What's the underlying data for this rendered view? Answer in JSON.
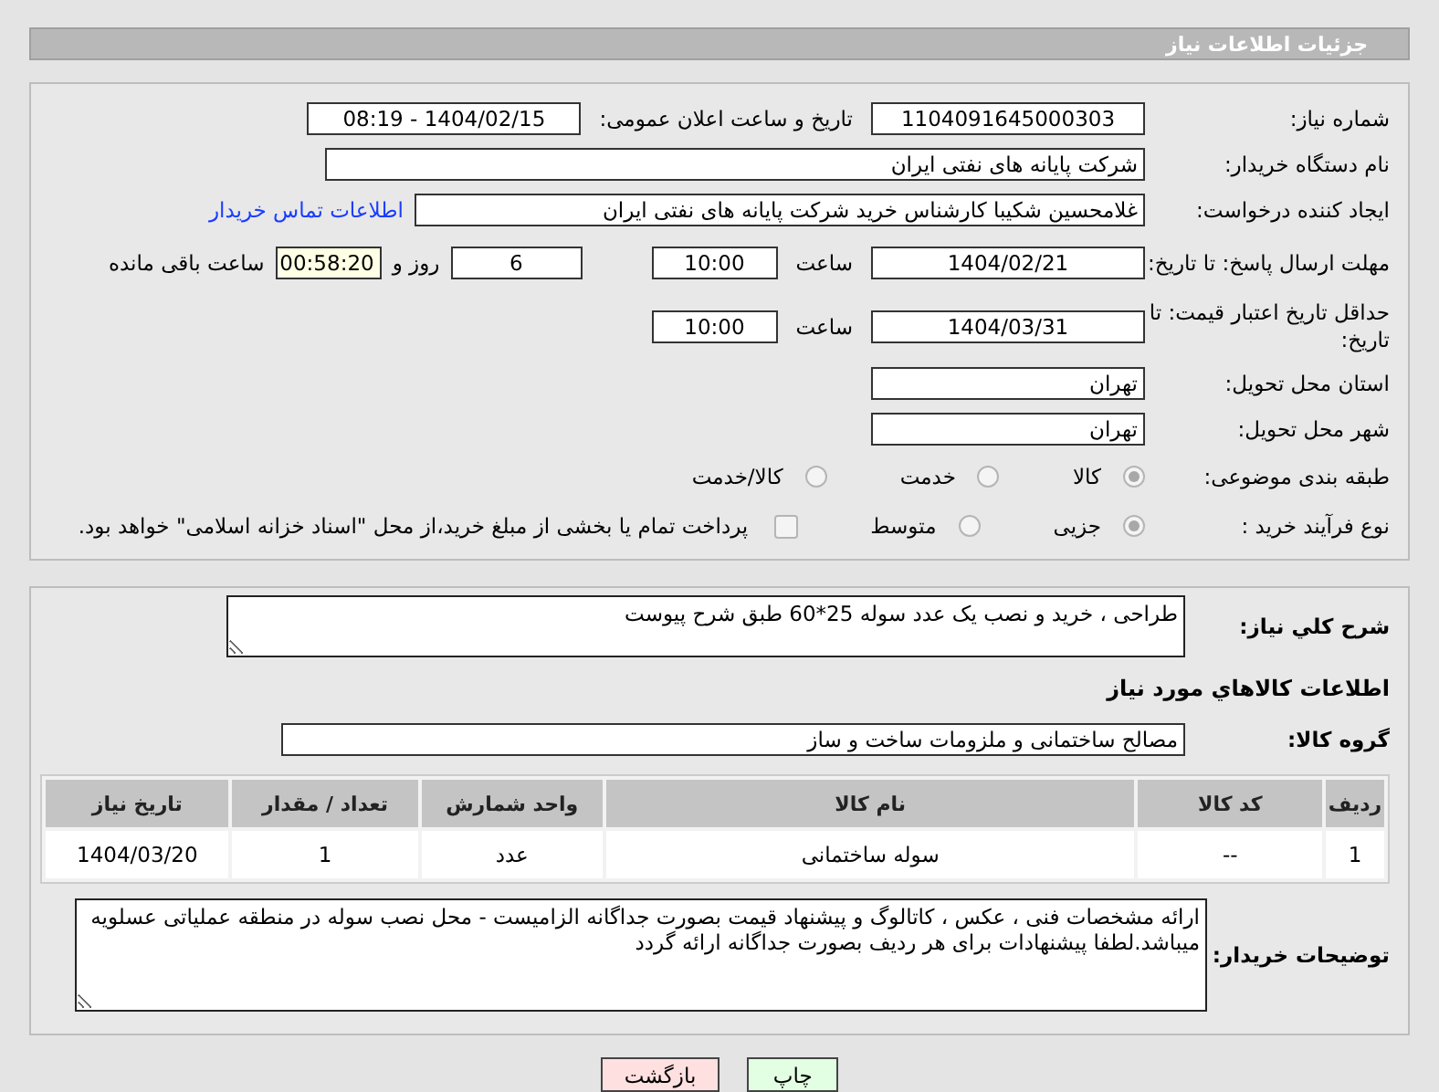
{
  "header": {
    "title": "جزئیات اطلاعات نیاز"
  },
  "need_number": {
    "label": "شماره نیاز:",
    "value": "1104091645000303"
  },
  "announce": {
    "label": "تاریخ و ساعت اعلان عمومی:",
    "value": "1404/02/15 - 08:19"
  },
  "buyer_org": {
    "label": "نام دستگاه خریدار:",
    "value": "شرکت پایانه های نفتی ایران"
  },
  "requester": {
    "label": "ایجاد کننده درخواست:",
    "value": "غلامحسین شکیبا کارشناس خرید شرکت پایانه های نفتی ایران",
    "link": "اطلاعات تماس خریدار"
  },
  "response_deadline": {
    "label": "مهلت ارسال پاسخ: تا تاریخ:",
    "date": "1404/02/21",
    "time_label": "ساعت",
    "time": "10:00",
    "days": "6",
    "days_label": "روز و",
    "remaining": "00:58:20",
    "remaining_label": "ساعت باقی مانده"
  },
  "price_validity": {
    "label": "حداقل تاریخ اعتبار قیمت: تا تاریخ:",
    "date": "1404/03/31",
    "time_label": "ساعت",
    "time": "10:00"
  },
  "province": {
    "label": "استان محل تحویل:",
    "value": "تهران"
  },
  "city": {
    "label": "شهر محل تحویل:",
    "value": "تهران"
  },
  "category": {
    "label": "طبقه بندی موضوعی:",
    "options": [
      {
        "label": "کالا",
        "selected": true
      },
      {
        "label": "خدمت",
        "selected": false
      },
      {
        "label": "کالا/خدمت",
        "selected": false
      }
    ]
  },
  "process": {
    "label": "نوع فرآیند خرید :",
    "options": [
      {
        "label": "جزیی",
        "selected": true
      },
      {
        "label": "متوسط",
        "selected": false
      }
    ],
    "payment": {
      "checked": false,
      "text": "پرداخت تمام یا بخشی از مبلغ خرید،از محل \"اسناد خزانه اسلامی\" خواهد بود."
    }
  },
  "description": {
    "label": "شرح کلي نياز:",
    "value": "طراحی ، خرید و نصب یک عدد سوله 25*60 طبق شرح پیوست"
  },
  "goods_heading": "اطلاعات كالاهاي مورد نياز",
  "goods_group": {
    "label": "گروه کالا:",
    "value": "مصالح ساختمانی و ملزومات ساخت و ساز"
  },
  "table": {
    "columns": [
      "ردیف",
      "کد کالا",
      "نام کالا",
      "واحد شمارش",
      "تعداد / مقدار",
      "تاریخ نیاز"
    ],
    "rows": [
      [
        "1",
        "--",
        "سوله ساختمانی",
        "عدد",
        "1",
        "1404/03/20"
      ]
    ]
  },
  "buyer_notes": {
    "label": "توضیحات خریدار:",
    "value": "ارائه مشخصات فنی ، عکس ، کاتالوگ و پیشنهاد قیمت بصورت جداگانه الزامیست - محل نصب سوله در منطقه عملیاتی عسلویه میباشد.لطفا پیشنهادات برای هر ردیف بصورت جداگانه ارائه گردد"
  },
  "buttons": [
    {
      "label": "چاپ",
      "kind": "print"
    },
    {
      "label": "بازگشت",
      "kind": "back"
    }
  ]
}
